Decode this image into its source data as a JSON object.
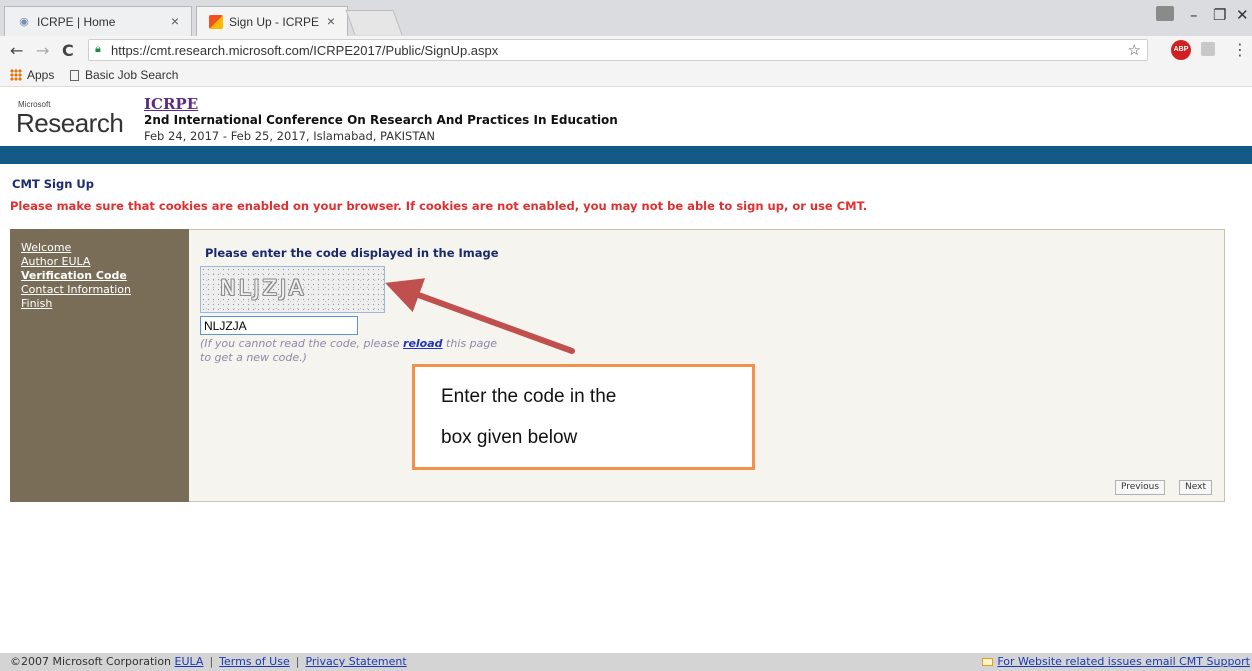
{
  "browser": {
    "tabs": [
      {
        "title": "ICRPE | Home",
        "close": "×"
      },
      {
        "title": "Sign Up - ICRPE",
        "close": "×"
      }
    ],
    "url": "https://cmt.research.microsoft.com/ICRPE2017/Public/SignUp.aspx",
    "nav": {
      "back": "←",
      "forward": "→",
      "reload": "C"
    },
    "window_controls": {
      "minimize": "–",
      "restore": "❐",
      "close": "✕"
    },
    "toolbar_icons": {
      "star": "☆",
      "abp": "ABP",
      "menu": "⋮"
    },
    "bookmarks": [
      {
        "label": "Apps",
        "icon": "apps-grid-icon"
      },
      {
        "label": "Basic Job Search",
        "icon": "page-icon"
      }
    ]
  },
  "header": {
    "logo_small": "Microsoft",
    "logo_large": "Research",
    "conference_acronym": "ICRPE",
    "conference_name": "2nd International Conference On Research And Practices In Education",
    "conference_dates": "Feb 24, 2017 - Feb 25, 2017, Islamabad, PAKISTAN"
  },
  "page": {
    "title": "CMT Sign Up",
    "cookie_warning": "Please make sure that cookies are enabled on your browser. If cookies are not enabled, you may not be able to sign up, or use CMT."
  },
  "sidebar": {
    "items": [
      {
        "label": "Welcome"
      },
      {
        "label": "Author EULA"
      },
      {
        "label": "Verification Code",
        "current": true
      },
      {
        "label": "Contact Information"
      },
      {
        "label": "Finish"
      }
    ]
  },
  "verification": {
    "prompt": "Please enter the code displayed in the Image",
    "captcha_text": "NLJZJA",
    "input_value": "NLJZJA",
    "hint_before": "(If you cannot read the code, please ",
    "hint_link": "reload",
    "hint_after": " this page",
    "hint_line2": "to get a new code.)"
  },
  "annotation": {
    "line1": "Enter the code in the",
    "line2": "box given below",
    "border_color": "#f2914a",
    "arrow_color": "#c0504d"
  },
  "buttons": {
    "previous": "Previous",
    "next": "Next"
  },
  "footer": {
    "copyright": "©2007 Microsoft Corporation",
    "links": [
      "EULA",
      "Terms of Use",
      "Privacy Statement"
    ],
    "separator": "|",
    "support_link": "For Website related issues email CMT Support"
  },
  "colors": {
    "header_bar": "#145a87",
    "sidebar_bg": "#7a6d57",
    "warning": "#e03030",
    "heading": "#1a2a6c"
  }
}
